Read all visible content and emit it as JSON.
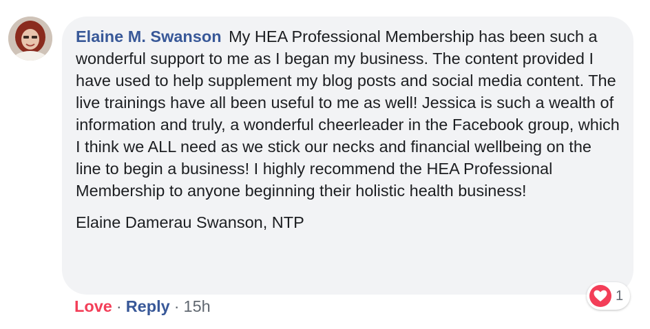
{
  "comment": {
    "author": "Elaine M. Swanson",
    "text": "My HEA Professional Membership has been such a wonderful support to me as I began my business. The content provided I have used to help supplement my blog posts and social media content. The live trainings have all been useful to me as well! Jessica is such a wealth of information and truly, a wonderful cheerleader in the Facebook group, which I think we ALL need as we stick our necks and financial wellbeing on the line to begin a business! I highly recommend the HEA Professional Membership to anyone beginning their holistic health business!",
    "signature": "Elaine Damerau Swanson, NTP"
  },
  "reactions": {
    "icon": "heart-icon",
    "count": "1",
    "color": "#f33e58"
  },
  "actions": {
    "love_label": "Love",
    "reply_label": "Reply",
    "separator": "·",
    "timestamp": "15h"
  },
  "colors": {
    "bubble_bg": "#f2f3f5",
    "author": "#385898",
    "love": "#f33e58",
    "meta": "#606770",
    "text": "#1c1e21"
  }
}
